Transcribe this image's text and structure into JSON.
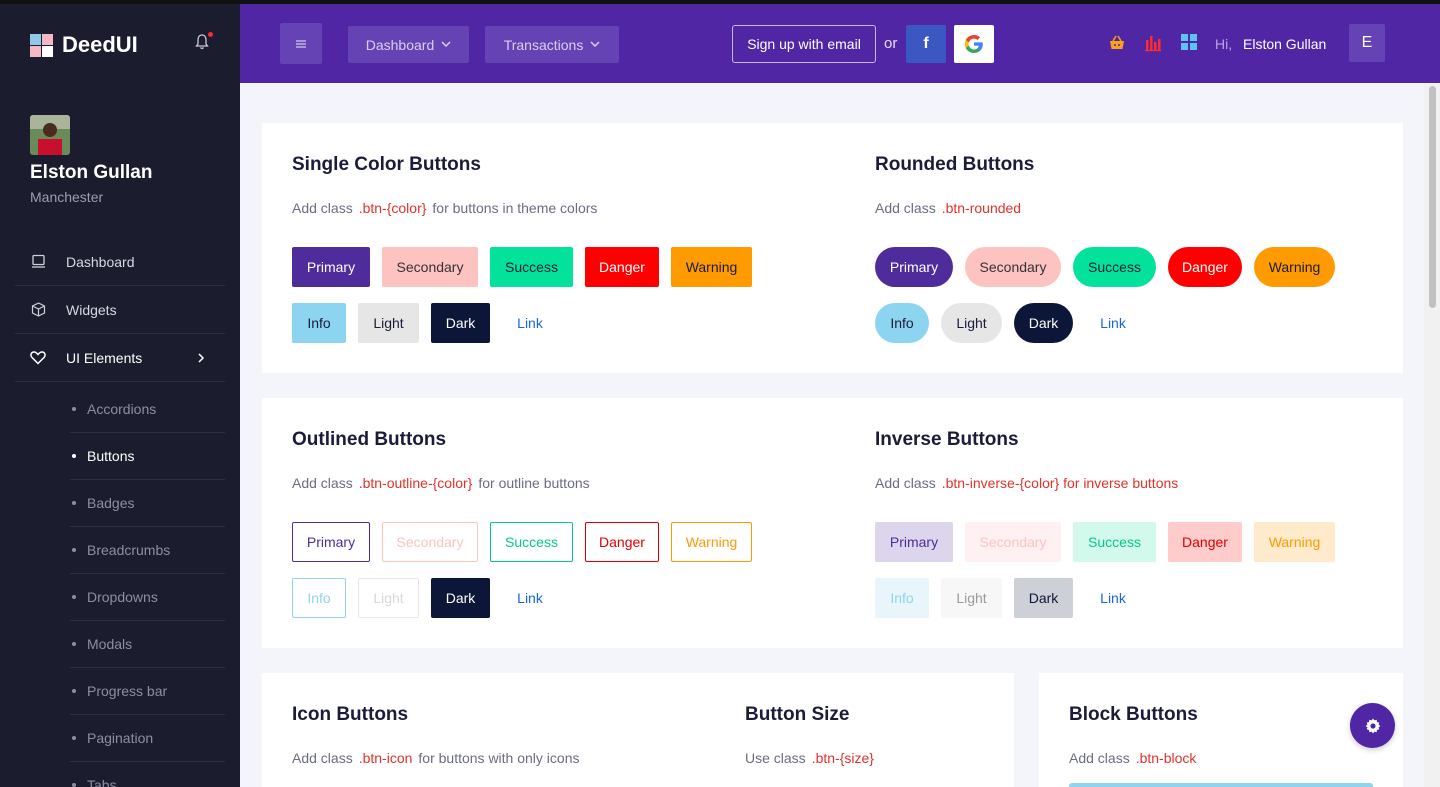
{
  "sidebar": {
    "brand": "DeedUI",
    "user": {
      "name": "Elston Gullan",
      "city": "Manchester"
    },
    "nav": [
      {
        "label": "Dashboard",
        "icon": "monitor-icon"
      },
      {
        "label": "Widgets",
        "icon": "cube-icon"
      },
      {
        "label": "UI Elements",
        "icon": "heart-icon"
      }
    ],
    "sub": [
      "Accordions",
      "Buttons",
      "Badges",
      "Breadcrumbs",
      "Dropdowns",
      "Modals",
      "Progress bar",
      "Pagination",
      "Tabs"
    ]
  },
  "header": {
    "menu_icon": "≡",
    "dashboard": "Dashboard",
    "transactions": "Transactions",
    "caret": "⌄",
    "signup": "Sign up with email",
    "or": "or",
    "facebook": "f",
    "hi": "Hi,",
    "user": "Elston Gullan",
    "avatar_letter": "E"
  },
  "sections": {
    "single": {
      "title": "Single Color Buttons",
      "pre": "Add class",
      "cls": ".btn-{color}",
      "post": "for buttons in theme colors"
    },
    "rounded": {
      "title": "Rounded Buttons",
      "pre": "Add class",
      "cls": ".btn-rounded",
      "post": ""
    },
    "outlined": {
      "title": "Outlined Buttons",
      "pre": "Add class",
      "cls": ".btn-outline-{color}",
      "post": "for outline buttons"
    },
    "inverse": {
      "title": "Inverse Buttons",
      "pre": "Add class",
      "cls": ".btn-inverse-{color} for inverse buttons",
      "post": ""
    },
    "icon": {
      "title": "Icon Buttons",
      "pre": "Add class",
      "cls": ".btn-icon",
      "post": "for buttons with only icons"
    },
    "size": {
      "title": "Button Size",
      "pre": "Use class",
      "cls": ".btn-{size}",
      "post": ""
    },
    "block": {
      "title": "Block Buttons",
      "pre": "Add class",
      "cls": ".btn-block",
      "post": ""
    }
  },
  "buttons": {
    "primary": "Primary",
    "secondary": "Secondary",
    "success": "Success",
    "danger": "Danger",
    "warning": "Warning",
    "info": "Info",
    "light": "Light",
    "dark": "Dark",
    "link": "Link"
  },
  "colors": {
    "primary": "#4f2c9c",
    "secondary": "#fdc3c0",
    "success": "#03e29a",
    "danger": "#ff0000",
    "warning": "#ff9a00",
    "info": "#8dd4f1",
    "light": "#e6e6e6",
    "dark": "#0c1638",
    "link": "#1a66e0"
  }
}
